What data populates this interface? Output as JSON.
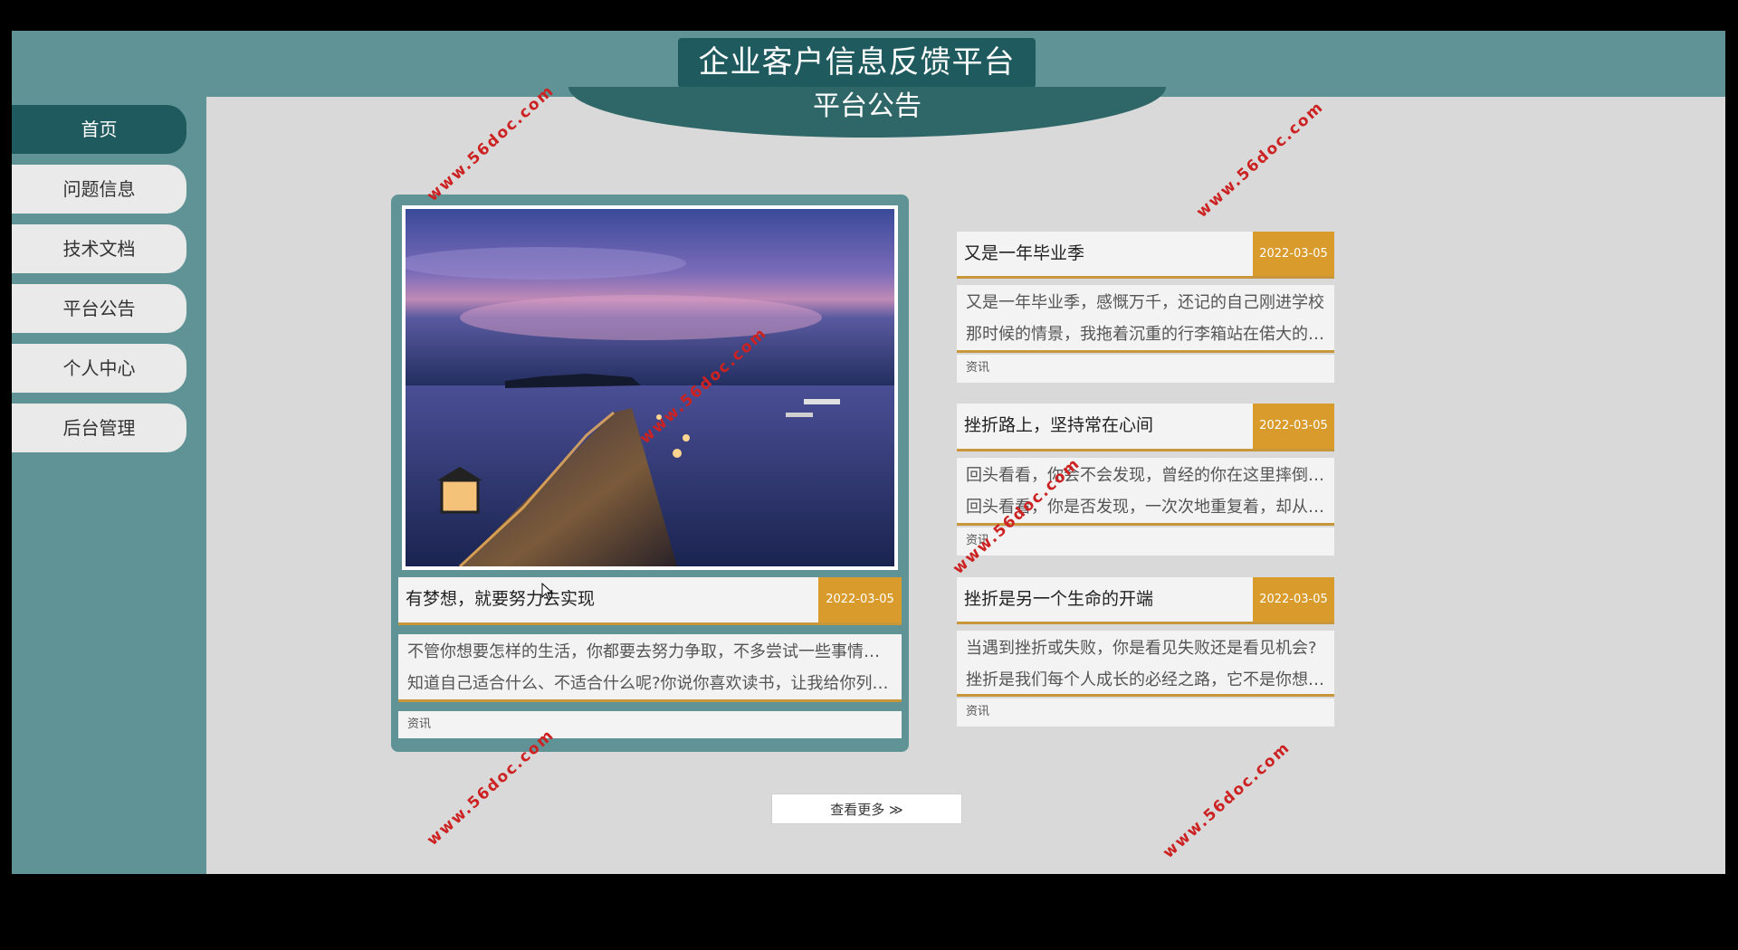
{
  "app": {
    "title": "企业客户信息反馈平台"
  },
  "sidebar": {
    "items": [
      {
        "label": "首页",
        "active": true
      },
      {
        "label": "问题信息"
      },
      {
        "label": "技术文档"
      },
      {
        "label": "平台公告"
      },
      {
        "label": "个人中心"
      },
      {
        "label": "后台管理"
      }
    ]
  },
  "section": {
    "title": "平台公告"
  },
  "feature": {
    "title": "有梦想，就要努力去实现",
    "date": "2022-03-05",
    "desc_line1": "不管你想要怎样的生活，你都要去努力争取，不多尝试一些事情怎么",
    "desc_line2": "知道自己适合什么、不适合什么呢?你说你喜欢读书，让我给你列…",
    "tag": "资讯"
  },
  "items": [
    {
      "title": "又是一年毕业季",
      "date": "2022-03-05",
      "desc_line1": "又是一年毕业季，感慨万千，还记的自己刚进学校",
      "desc_line2": "那时候的情景，我拖着沉重的行李箱站在偌大的…",
      "tag": "资讯"
    },
    {
      "title": "挫折路上，坚持常在心间",
      "date": "2022-03-05",
      "desc_line1": "回头看看，你会不会发现，曾经的你在这里摔倒过;",
      "desc_line2": "回头看看，你是否发现，一次次地重复着，却从…",
      "tag": "资讯"
    },
    {
      "title": "挫折是另一个生命的开端",
      "date": "2022-03-05",
      "desc_line1": "当遇到挫折或失败，你是看见失败还是看见机会?",
      "desc_line2": "挫折是我们每个人成长的必经之路，它不是你想…",
      "tag": "资讯"
    }
  ],
  "more": {
    "label": "查看更多"
  },
  "watermark": "www.56doc.com",
  "colors": {
    "teal": "#5f9396",
    "dark_teal": "#1f5b5e",
    "gold": "#d99b2c",
    "panel": "#d9d9d9"
  }
}
